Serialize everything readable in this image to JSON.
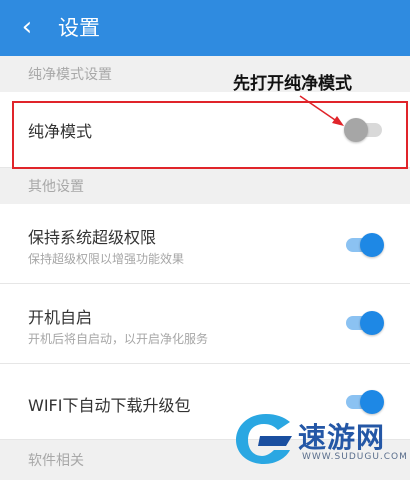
{
  "header": {
    "back_icon": "chevron-left-icon",
    "title": "设置"
  },
  "sections": {
    "pure_mode": "纯净模式设置",
    "other": "其他设置",
    "software": "软件相关"
  },
  "settings": {
    "pure_mode": {
      "title": "纯净模式",
      "enabled": false
    },
    "root_keep": {
      "title": "保持系统超级权限",
      "subtitle": "保持超级权限以增强功能效果",
      "enabled": true
    },
    "auto_start": {
      "title": "开机自启",
      "subtitle": "开机后将自启动，以开启净化服务",
      "enabled": true
    },
    "wifi_download": {
      "title": "WIFI下自动下载升级包",
      "enabled": true
    }
  },
  "annotation": {
    "text": "先打开纯净模式",
    "color": "#e0242a"
  },
  "watermark": {
    "text": "速游网",
    "url": "WWW.SUDUGU.COM"
  },
  "colors": {
    "accent": "#2f8be0",
    "toggle_on": "#1e88e5"
  }
}
